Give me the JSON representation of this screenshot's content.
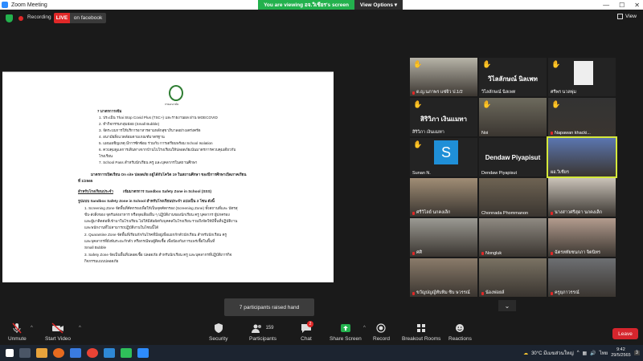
{
  "window": {
    "title": "Zoom Meeting",
    "viewing_banner": "You are viewing อจ.วิเชียร's screen",
    "view_options": "View Options"
  },
  "status": {
    "recording_label": "Recording",
    "live_badge": "LIVE",
    "live_destination": "on facebook",
    "view_label": "View"
  },
  "document": {
    "logo_caption": "กรมอนามัย",
    "section_title": "7 มาตรการเข้ม",
    "items": [
      "1.    ประเมิน Thai Stop Covid Plus (TSC+) และรายงานผล ผ่าน MOECOVID",
      "2.    ทำกิจกรรมกลุ่มย่อย (Small Bubble)",
      "3.    จัดระบบการให้บริการอาหารตามหลักสุขาภิบาลอย่างเคร่งครัด",
      "4.    อนามัยสิ่งแวดล้อมตามเกณฑ์มาตรฐาน",
      "5.    แผนเผชิญเหตุ มีการซักซ้อม ร่วมกับ การเตรียมพร้อม School Isolation",
      "6.    ควบคุมดูแลการเดินทางจากบ้านไปโรงเรียนให้ปลอดภัยเน้นมาตรการควบคุมเดียวกับ",
      "       โรงเรียน",
      "7.    School Pass สำหรับนักเรียน ครู และบุคลากรในสถานศึกษา"
    ],
    "onsite_heading": "มาตรการเปิดเรียน On site ปลอดภัย อยู่ได้กับโควิด 19 ในสถานศึกษา ของปีการศึกษาเปิดภาคเรียน",
    "onsite_heading_2": "ที่ 1/2565",
    "sandbox_label": "สำหรับโรงเรียนประจำ",
    "sandbox_desc": "    เข้มมาตรการ Sandbox Safety Zone in School (SSS)",
    "model_line": "รูปแบบ Sandbox Safety Zone in School สำหรับโรงเรียนประจำ แบ่งเป็น 3 โซน ดังนี้",
    "zones": [
      "1.    Screening Zone จัดพื้นที่คัดกรองเพื่อให้เป็นจุดคัดกรอง (Screening Zone) ทั้งสถานที่และ บัตรสุ",
      "       ขีบ-ส่งสิ่งของ จุดรับส่งอาหาร หรือจุดเสี่ยงอื่น ๆ ปฏิบัติงานของนักเรียน ครู บุคลากร ผู้ปกครอง",
      "       และผู้มาติดต่อที่เข้ามาในโรงเรียน ไม่ให้มีสัมผัสกับบุคคลในโรงเรียน รวมถึงจัดให้มีพื้นที่ปฏิบัติงาน",
      "       และพนักงานที่ไม่สามารถปฏิบัติงานในโซนนี้ได้",
      "2.    Quarantine Zone จัดพื้นที่เรียนกักกันโรคที่มีอยู่เพื่อแยกกักตัวนักเรียน สำหรับนักเรียน ครู",
      "       และบุคลากรที่ยังพ้นระยะกักตัว หรือกรณีพบผู้ติดเชื้อ เพื่อป้องกันการแพร่เชื้อในพื้นที่",
      "       Small Bubble",
      "3.    Safety Zone จัดเป็นพื้นที่ปลอดเชื้อ ปลอดภัย สำหรับนักเรียน ครู และบุคลากรที่ปฏิบัติภารกิจ",
      "       กิจกรรมแบบปลอดภัย"
    ]
  },
  "participants": [
    {
      "name": "ด.ญ.นภาพร แซ่จิว ป.1/2",
      "hand": true,
      "muted": true,
      "kind": "video",
      "color": "#b7b4a8"
    },
    {
      "name": "วิไลลักษณ์ นิลเพท",
      "hand": true,
      "muted": false,
      "kind": "bigname",
      "color": "#232323"
    },
    {
      "name": "ศรีพร นวลพุ่ม",
      "hand": true,
      "muted": false,
      "kind": "avatar",
      "color": "#232323"
    },
    {
      "name": "สิริวิภา เงินแมทา",
      "hand": true,
      "muted": false,
      "kind": "bigname",
      "color": "#232323"
    },
    {
      "name": "Noi",
      "hand": true,
      "muted": false,
      "kind": "video",
      "color": "#6d6a5d"
    },
    {
      "name": "Napawan khacki...",
      "hand": true,
      "muted": true,
      "kind": "video",
      "color": "#333333"
    },
    {
      "name": "Sunan N.",
      "hand": true,
      "muted": false,
      "kind": "letter",
      "letter": "S",
      "color": "#232323"
    },
    {
      "name": "Dendaw Piyapisut",
      "hand": false,
      "muted": false,
      "kind": "bigname",
      "color": "#232323"
    },
    {
      "name": "ผอ.วิเชียร",
      "hand": false,
      "muted": false,
      "kind": "video",
      "color": "#5b76b0",
      "active": true
    },
    {
      "name": "ศรีวิไลย์ นกคงเล็ก",
      "hand": false,
      "muted": true,
      "kind": "video",
      "color": "#a08d75"
    },
    {
      "name": "Chonnada Phommanon",
      "hand": false,
      "muted": false,
      "kind": "video",
      "color": "#6e6353"
    },
    {
      "name": "นางสาวศรีสุดา นกคงเล็ก",
      "hand": false,
      "muted": true,
      "kind": "video",
      "color": "#c9c2b8"
    },
    {
      "name": "ศศิ",
      "hand": false,
      "muted": true,
      "kind": "video",
      "color": "#9b9a93"
    },
    {
      "name": "Nongluk",
      "hand": false,
      "muted": true,
      "kind": "video",
      "color": "#8f8a82"
    },
    {
      "name": "ฉัตรหทัยชนกภา จิตนิทร",
      "hand": false,
      "muted": true,
      "kind": "video",
      "color": "#b39c8e"
    },
    {
      "name": "ขวัญปญญ์ทับทิม ซิบ ษวรรณ์",
      "hand": false,
      "muted": true,
      "kind": "video",
      "color": "#8a7b6a"
    },
    {
      "name": "น้องฟอยล์",
      "hand": false,
      "muted": true,
      "kind": "video",
      "color": "#7a7263"
    },
    {
      "name": "ครูยุภาวรรณ์",
      "hand": false,
      "muted": true,
      "kind": "video",
      "color": "#6d6f72"
    }
  ],
  "raised_hand_toast": "7 participants raised hand",
  "toolbar": {
    "unmute": "Unmute",
    "start_video": "Start Video",
    "security": "Security",
    "participants": "Participants",
    "participants_count": "159",
    "chat": "Chat",
    "chat_badge": "2",
    "share_screen": "Share Screen",
    "record": "Record",
    "breakout": "Breakout Rooms",
    "reactions": "Reactions",
    "leave": "Leave"
  },
  "taskbar": {
    "weather": "30°C มีเมฆส่วนใหญ่",
    "language": "ไทย",
    "time": "9:42",
    "date": "29/5/2565",
    "notifications": "3"
  },
  "colors": {
    "live": "#e02828",
    "share_green": "#23b14d",
    "leave": "#d6252d",
    "raised_hand": "#f4c430"
  }
}
